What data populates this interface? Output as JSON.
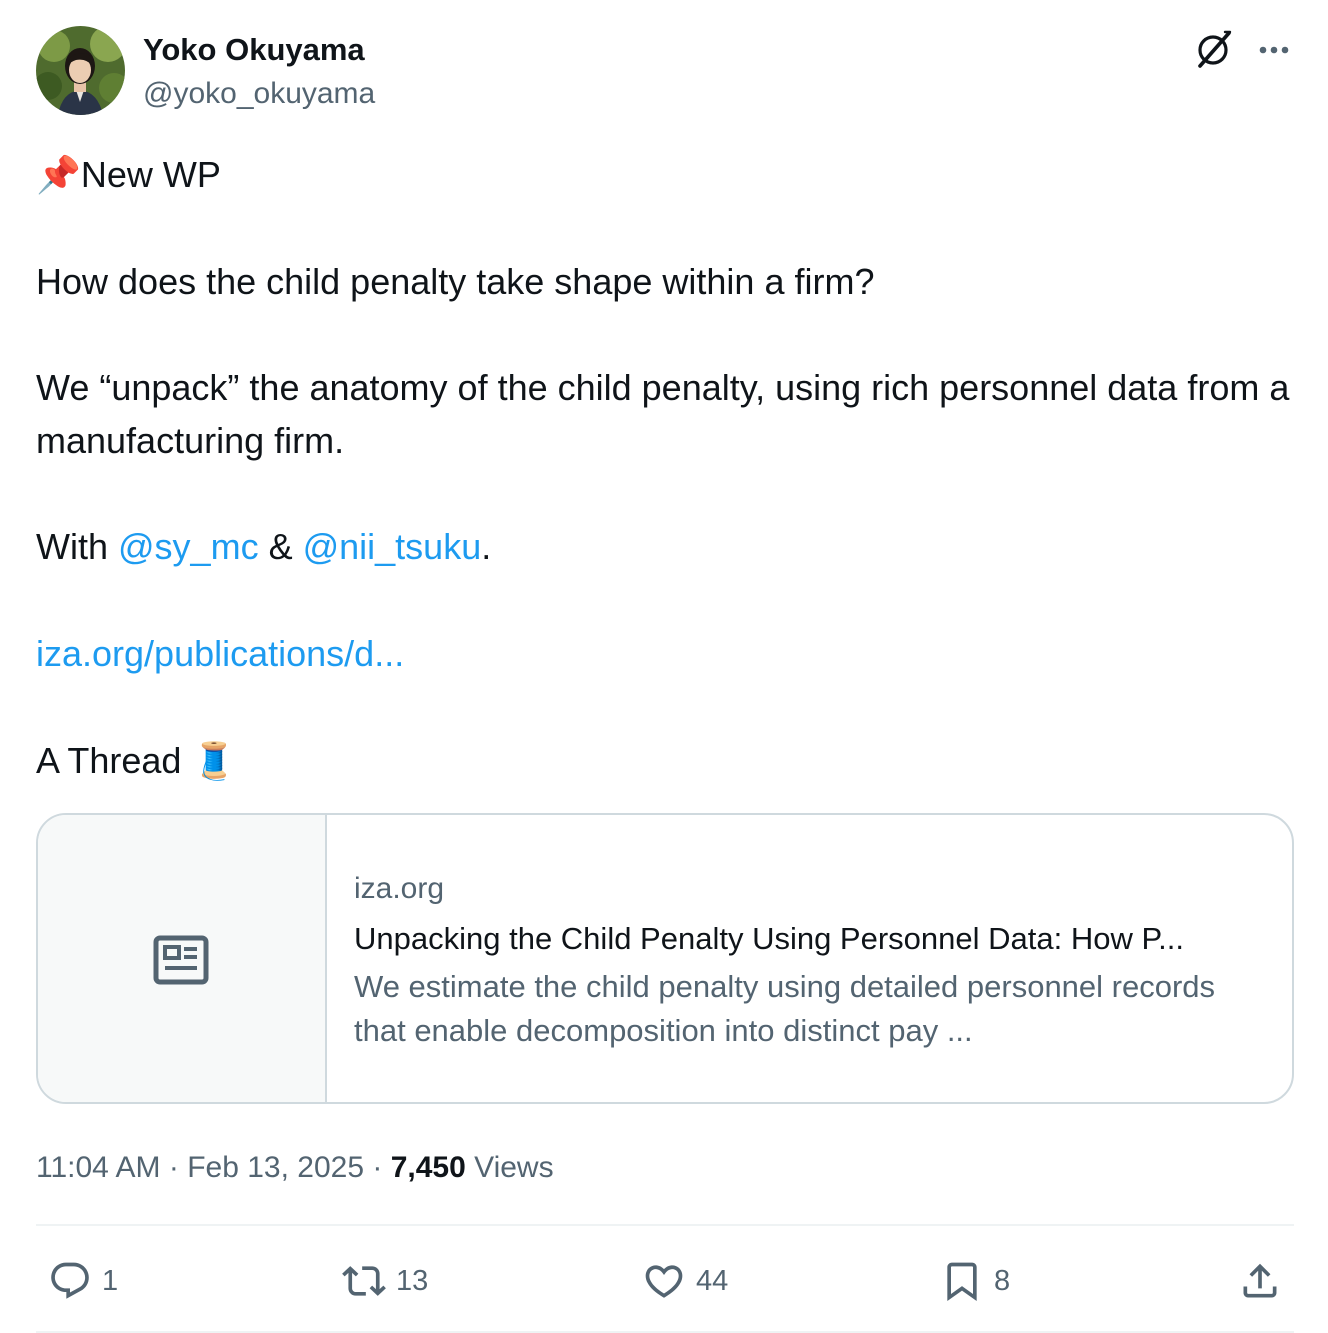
{
  "author": {
    "display_name": "Yoko Okuyama",
    "handle": "@yoko_okuyama",
    "avatar_icon": "profile-photo"
  },
  "post": {
    "line1_text": "New WP",
    "line1_emoji": "📌",
    "question": "How does the child penalty take shape within a firm?",
    "paragraph": "We “unpack” the anatomy of the child penalty, using rich personnel data from a manufacturing firm.",
    "with_prefix": "With ",
    "mention1": "@sy_mc",
    "amp": " & ",
    "mention2": "@nii_tsuku",
    "period": ".",
    "url": "iza.org/publications/d...",
    "thread_text": "A Thread ",
    "thread_emoji": "🧵"
  },
  "card": {
    "domain": "iza.org",
    "title": "Unpacking the Child Penalty Using Personnel Data: How P...",
    "description": "We estimate the child penalty using detailed personnel records that enable decomposition into distinct pay ...",
    "thumb_icon": "article-icon"
  },
  "meta": {
    "time": "11:04 AM",
    "sep1": " · ",
    "date": "Feb 13, 2025",
    "sep2": " · ",
    "views_count": "7,450",
    "views_label": " Views"
  },
  "actions": {
    "replies": "1",
    "reposts": "13",
    "likes": "44",
    "bookmarks": "8"
  },
  "colors": {
    "link": "#1d9bf0",
    "secondary_text": "#536471",
    "primary_text": "#0f1419",
    "border": "#cfd9de"
  }
}
